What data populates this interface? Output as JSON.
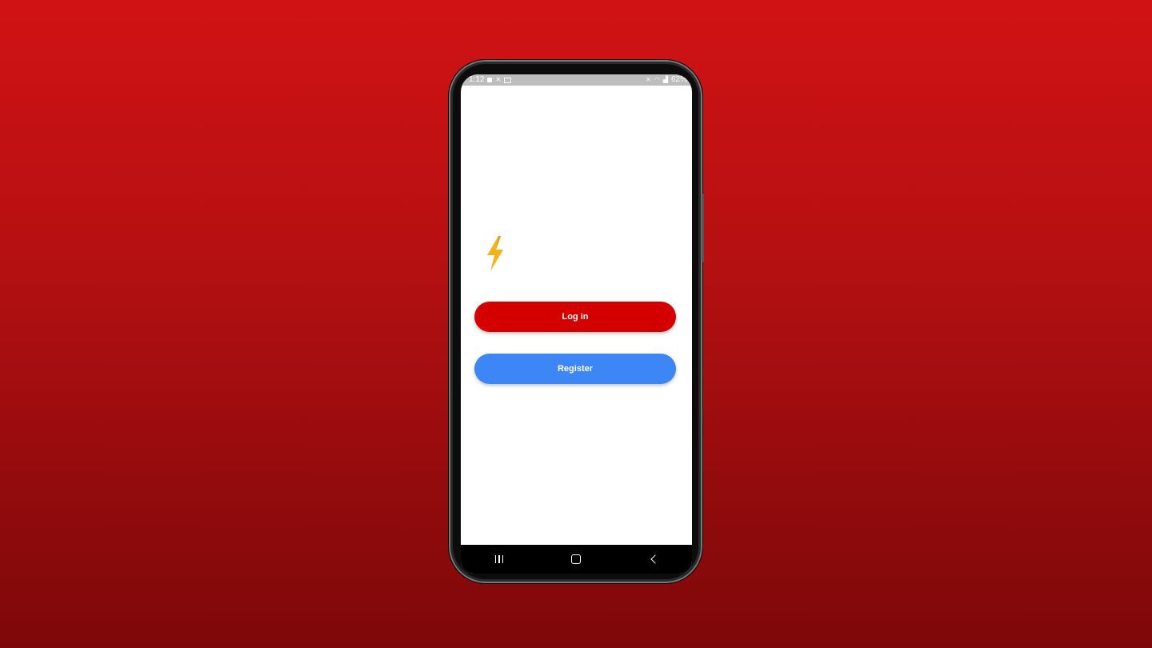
{
  "status_bar": {
    "time": "1:12",
    "battery": "62%"
  },
  "icons": {
    "logo": "lightning-bolt-icon",
    "logo_color": "#f6b21b"
  },
  "buttons": {
    "login_label": "Log in",
    "register_label": "Register"
  },
  "colors": {
    "background_top": "#d11214",
    "background_bottom": "#7e0809",
    "login_button": "#d40000",
    "register_button": "#3d86f6"
  },
  "nav_bar": {
    "recents": "recents-icon",
    "home": "home-icon",
    "back": "back-icon"
  }
}
